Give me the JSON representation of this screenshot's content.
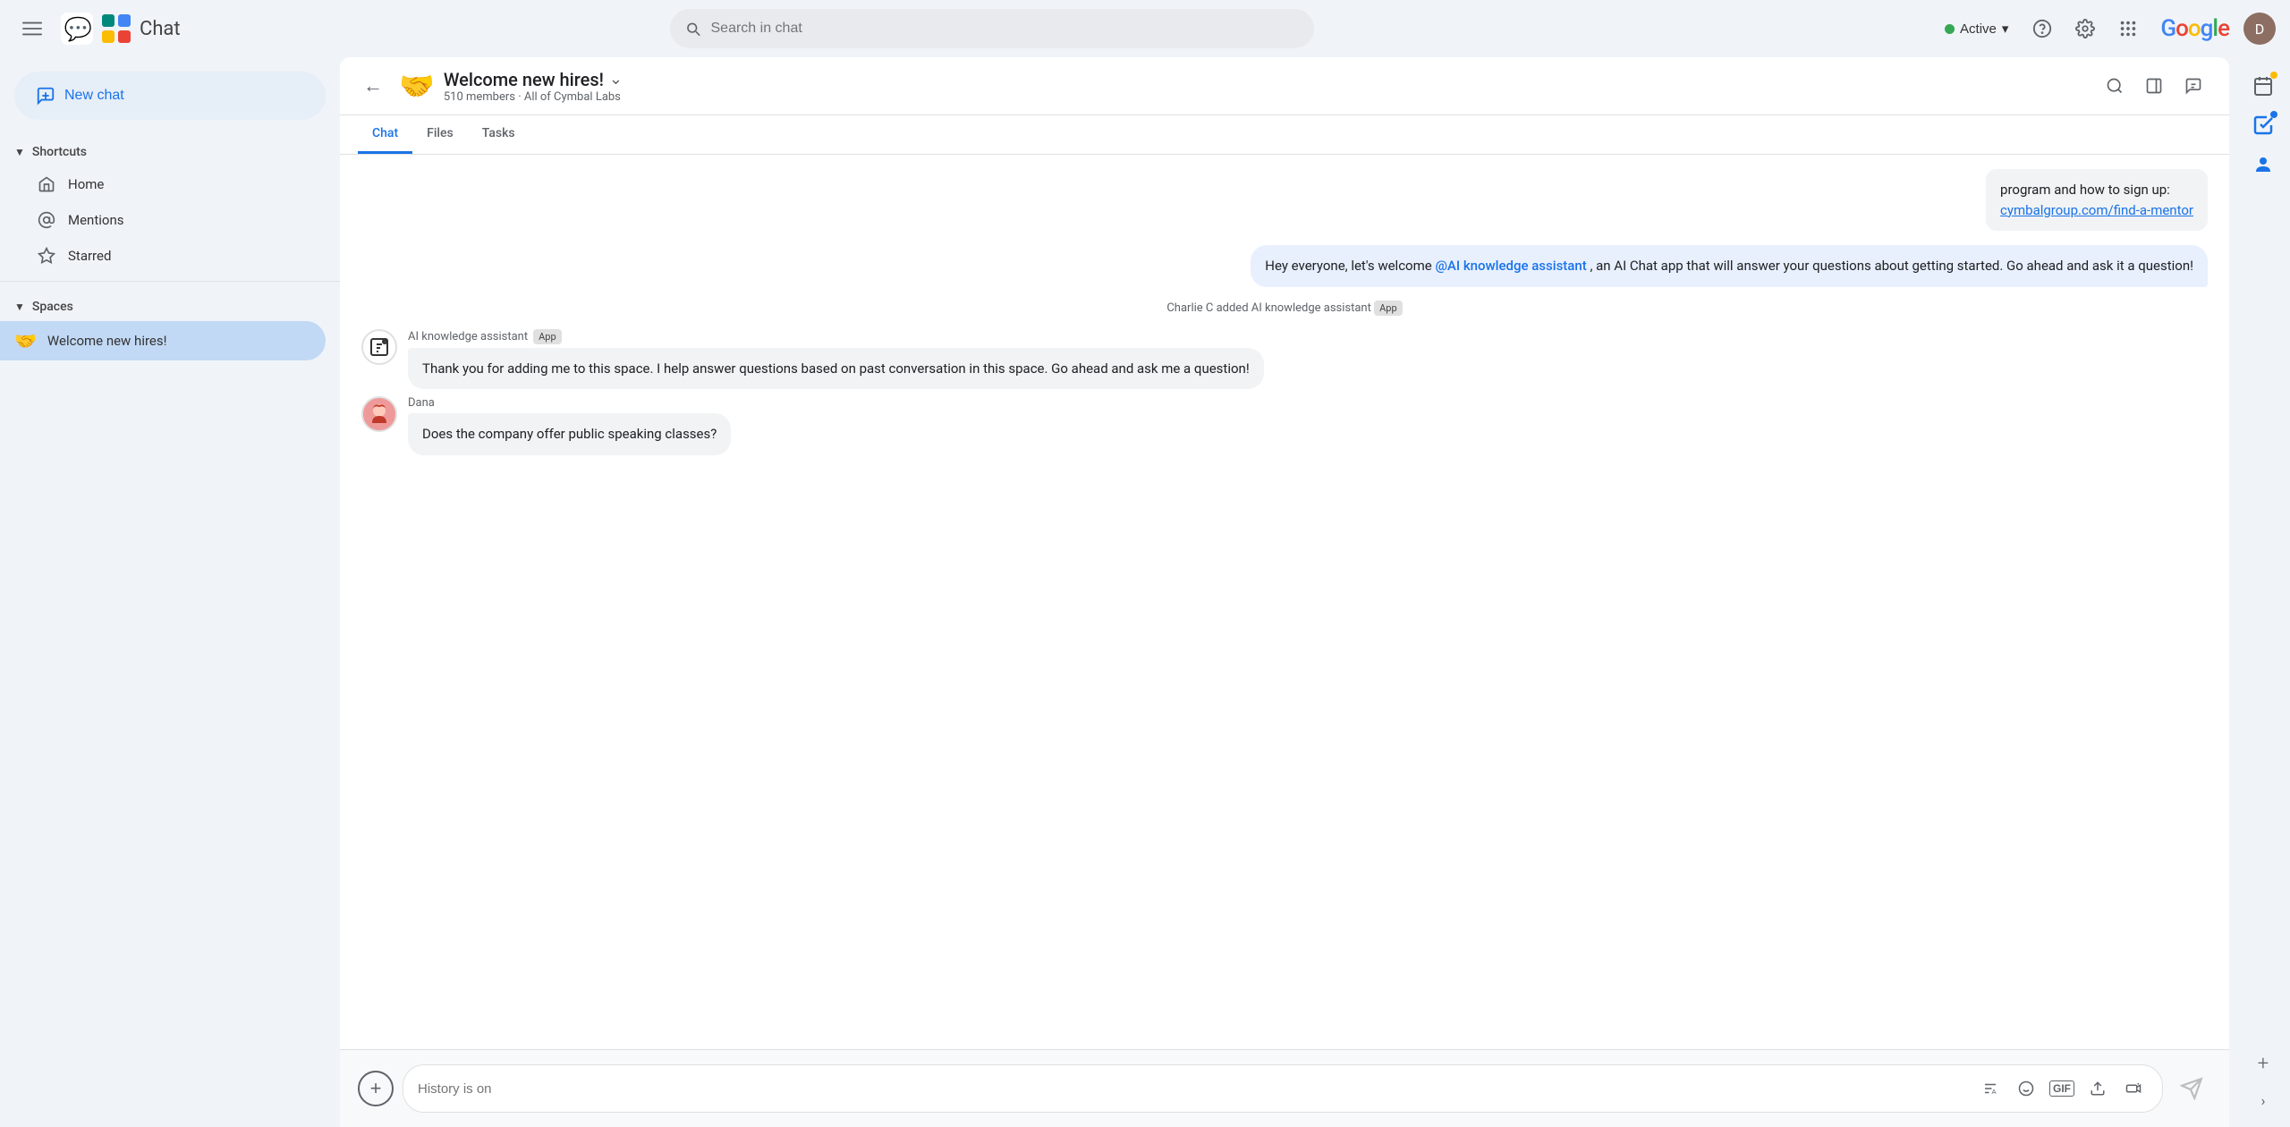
{
  "topbar": {
    "menu_icon": "☰",
    "app_name": "Chat",
    "search_placeholder": "Search in chat",
    "active_label": "Active",
    "chevron": "▾",
    "help_icon": "?",
    "settings_icon": "⚙",
    "grid_icon": "⋮⋮⋮",
    "google_label": "Google",
    "avatar_letter": "D"
  },
  "sidebar": {
    "new_chat_label": "New chat",
    "shortcuts_label": "Shortcuts",
    "home_label": "Home",
    "mentions_label": "Mentions",
    "starred_label": "Starred",
    "spaces_label": "Spaces",
    "space_item_label": "Welcome new hires!",
    "space_item_emoji": "🤝"
  },
  "chat_header": {
    "back_icon": "←",
    "emoji": "🤝",
    "title": "Welcome new hires!",
    "chevron": "⌄",
    "meta_members": "510 members",
    "meta_sep": "·",
    "meta_org": "All of Cymbal Labs",
    "search_icon": "search",
    "panel_icon": "panel",
    "thread_icon": "thread"
  },
  "tabs": [
    {
      "label": "Chat",
      "active": true
    },
    {
      "label": "Files",
      "active": false
    },
    {
      "label": "Tasks",
      "active": false
    }
  ],
  "messages": {
    "prev_bubble_text": "program and how to sign up:",
    "prev_bubble_link": "cymbalgroup.com/find-a-mentor",
    "charlie_message": "Hey everyone, let's welcome @AI knowledge assistant, an AI Chat app that will answer your questions about getting started.  Go ahead and ask it a question!",
    "charlie_mention": "@AI knowledge assistant",
    "system_text": "Charlie C added AI knowledge assistant",
    "system_app_badge": "App",
    "ai_sender": "AI knowledge assistant",
    "ai_app_badge": "App",
    "ai_message": "Thank you for adding me to this space. I help answer questions based on past conversation in this space. Go ahead and ask me a question!",
    "dana_sender": "Dana",
    "dana_message": "Does the company offer public speaking classes?"
  },
  "input_bar": {
    "placeholder": "History is on",
    "add_icon": "+",
    "text_icon": "A",
    "emoji_icon": "☺",
    "gif_icon": "GIF",
    "upload_icon": "↑",
    "video_icon": "▭+",
    "send_icon": "▷"
  },
  "right_sidebar": {
    "calendar_icon": "📅",
    "tasks_icon": "✓",
    "contacts_icon": "👤",
    "add_icon": "+",
    "chevron_icon": "›"
  }
}
